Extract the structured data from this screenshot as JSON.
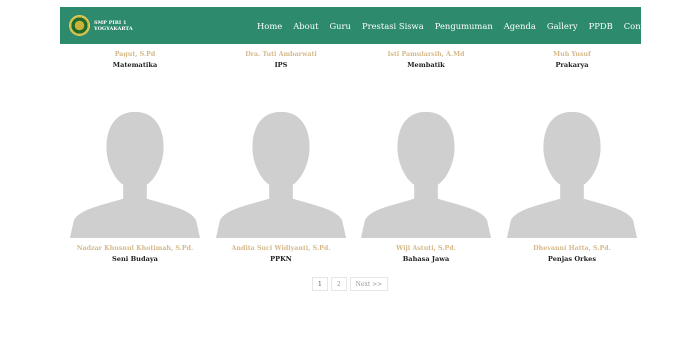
{
  "brand": {
    "logo": "school-emblem",
    "line1": "SMP PIRI 1",
    "line2": "YOGYAKARTA"
  },
  "nav": {
    "items": [
      {
        "label": "Home"
      },
      {
        "label": "About"
      },
      {
        "label": "Guru"
      },
      {
        "label": "Prestasi Siswa"
      },
      {
        "label": "Pengumuman"
      },
      {
        "label": "Agenda"
      },
      {
        "label": "Gallery"
      },
      {
        "label": "PPDB"
      },
      {
        "label": "Contact"
      }
    ]
  },
  "teachers_top": [
    {
      "name": "Pagut, S.Pd",
      "subject": "Matematika"
    },
    {
      "name": "Dra. Tuti Ambarwati",
      "subject": "IPS"
    },
    {
      "name": "Isti Pamularsih, A.Md",
      "subject": "Membatik"
    },
    {
      "name": "Muh Yusuf",
      "subject": "Prakarya"
    }
  ],
  "teachers_bottom": [
    {
      "name": "Nadzar Khusnul Khotimah, S.Pd.",
      "subject": "Seni Budaya"
    },
    {
      "name": "Andita Suci Widiyanti, S.Pd.",
      "subject": "PPKN"
    },
    {
      "name": "Wiji Astuti, S.Pd.",
      "subject": "Bahasa Jawa"
    },
    {
      "name": "Dhevanni Hatta, S.Pd.",
      "subject": "Penjas Orkes"
    }
  ],
  "pagination": {
    "pages": [
      "1",
      "2"
    ],
    "next_label": "Next >>"
  },
  "colors": {
    "navbar": "#2e8a6c",
    "name_text": "#d5b98a",
    "avatar": "#cfcfcf"
  }
}
